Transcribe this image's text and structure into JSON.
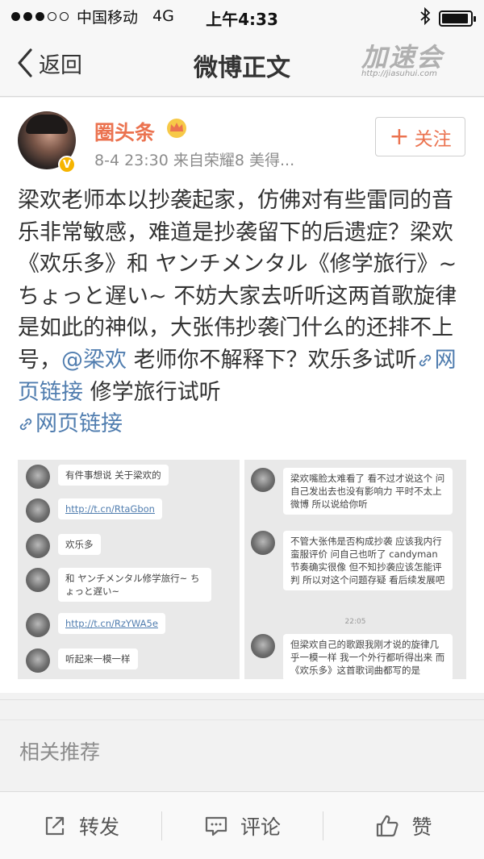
{
  "status_bar": {
    "carrier": "中国移动",
    "network": "4G",
    "time": "上午4:33"
  },
  "nav": {
    "title": "微博正文",
    "back_label": "返回",
    "watermark_brand": "加速会",
    "watermark_url": "http://jiasuhui.com"
  },
  "post": {
    "author": "圈头条",
    "meta": "8-4 23:30 来自荣耀8 美得...",
    "follow_label": "关注",
    "text_part1": "梁欢老师本以抄袭起家，仿佛对有些雷同的音乐非常敏感，难道是抄袭留下的后遗症？梁欢《欢乐多》和 ヤンチメンタル《修学旅行》~ちょっと遅い~ 不妨大家去听听这两首歌旋律是如此的神似，大张伟抄袭门什么的还排不上号，",
    "mention": "@梁欢",
    "text_part2": " 老师你不解释下？欢乐多试听",
    "link1": "网页链接",
    "text_part3": " 修学旅行试听",
    "link2": "网页链接"
  },
  "images": {
    "left_chat": [
      {
        "text": "有件事想说 关于梁欢的",
        "type": "text"
      },
      {
        "text": "http://t.cn/RtaGbon",
        "type": "url"
      },
      {
        "text": "欢乐多",
        "type": "text"
      },
      {
        "text": "和 ヤンチメンタル修学旅行~ ちょっと遅い~",
        "type": "text"
      },
      {
        "text": "http://t.cn/RzYWA5e",
        "type": "url"
      },
      {
        "text": "听起来一模一样",
        "type": "text"
      }
    ],
    "right_chat": [
      {
        "text": "梁欢嘴脸太难看了 看不过才说这个 问自己发出去也没有影响力 平时不太上微博 所以说给你听",
        "type": "text"
      },
      {
        "text": "不管大张伟是否构成抄袭 应该我内行蛮服评价 问自己也听了 candyman 节奏确实很像 但不知抄袭应该怎能评判 所以对这个问题存疑 看后续发展吧",
        "type": "text"
      },
      {
        "text": "22:05",
        "type": "time"
      },
      {
        "text": "但梁欢自己的歌跟我刚才说的旋律几乎一模一样 我一个外行都听得出来 而《欢乐多》这首歌词曲都写的是",
        "type": "text"
      }
    ]
  },
  "related": {
    "label": "相关推荐"
  },
  "actions": {
    "repost": "转发",
    "comment": "评论",
    "like": "赞"
  },
  "colors": {
    "accent": "#eb7350",
    "link": "#507daf",
    "verified": "#f6b400"
  }
}
